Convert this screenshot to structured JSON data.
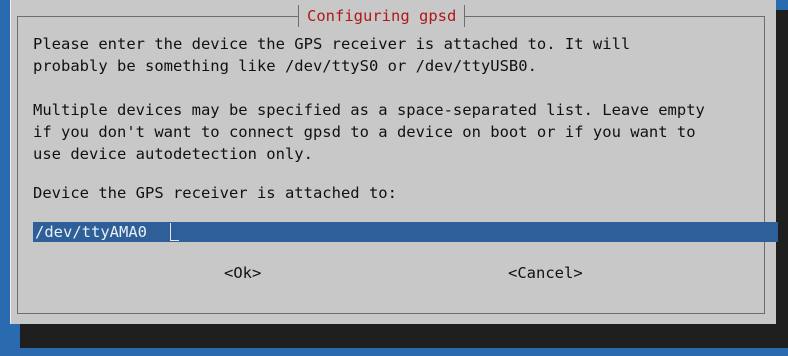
{
  "dialog": {
    "title": "Configuring gpsd",
    "lines": [
      "Please enter the device the GPS receiver is attached to. It will",
      "probably be something like /dev/ttyS0 or /dev/ttyUSB0.",
      "",
      "Multiple devices may be specified as a space-separated list. Leave empty",
      "if you don't want to connect gpsd to a device on boot or if you want to",
      "use device autodetection only.",
      "",
      "Device the GPS receiver is attached to:"
    ],
    "input_value": "/dev/ttyAMA0",
    "ok_label": "<Ok>",
    "cancel_label": "<Cancel>"
  },
  "colors": {
    "background": "#2a6bb0",
    "dialog": "#c8c8c8",
    "title_text": "#b01818",
    "input_bg": "#2f5f98",
    "shadow": "#1f1f1f"
  }
}
